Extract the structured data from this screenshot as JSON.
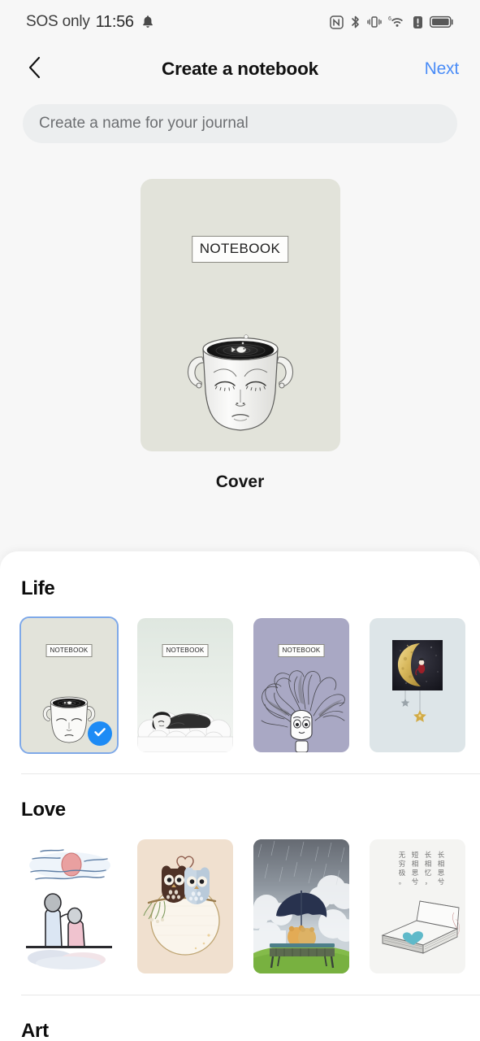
{
  "status_bar": {
    "carrier": "SOS only",
    "time": "11:56",
    "icons": [
      "bell-icon",
      "nfc-icon",
      "bluetooth-icon",
      "vibrate-icon",
      "wifi6-icon",
      "alert-icon",
      "battery-icon"
    ]
  },
  "nav": {
    "back_icon": "chevron-left-icon",
    "title": "Create a notebook",
    "next_label": "Next",
    "next_color": "#4a8cf7"
  },
  "name_input": {
    "value": "",
    "placeholder": "Create a name for your journal"
  },
  "preview": {
    "label": "Cover",
    "notebook_tag": "NOTEBOOK",
    "background": "#e2e3da",
    "art": "face-cup-fish"
  },
  "selection": {
    "selected_section": "Life",
    "selected_index": 0,
    "check_color": "#1d8bf5",
    "border_color": "#7fa9e8"
  },
  "sections": [
    {
      "title": "Life",
      "covers": [
        {
          "art": "face-cup-fish",
          "background": "#e2e3da",
          "notebook_tag": "NOTEBOOK",
          "selected": true
        },
        {
          "art": "sleeping-child-on-clouds",
          "background": "#e3eae4",
          "notebook_tag": "NOTEBOOK",
          "selected": false
        },
        {
          "art": "girl-with-flowing-hair",
          "background": "#a9a8c4",
          "notebook_tag": "NOTEBOOK",
          "selected": false
        },
        {
          "art": "crescent-moon-with-stars",
          "background": "#dde5e8",
          "notebook_tag": "",
          "selected": false
        }
      ]
    },
    {
      "title": "Love",
      "covers": [
        {
          "art": "couple-watching-sunset",
          "background": "#ffffff",
          "notebook_tag": "",
          "selected": false
        },
        {
          "art": "two-owls-with-heart",
          "background": "#f0e0cf",
          "notebook_tag": "",
          "selected": false
        },
        {
          "art": "teddy-bears-bench-umbrella-rain",
          "background": "#9aa2ab",
          "notebook_tag": "",
          "selected": false
        },
        {
          "art": "open-book-with-heart-chinese-poem",
          "background": "#f4f4f2",
          "notebook_tag": "",
          "selected": false
        }
      ]
    },
    {
      "title": "Art",
      "covers": []
    }
  ],
  "poem": {
    "line1": "长相思兮",
    "line2": "长相忆，",
    "line3": "短相思兮",
    "line4": "无穷极。"
  }
}
